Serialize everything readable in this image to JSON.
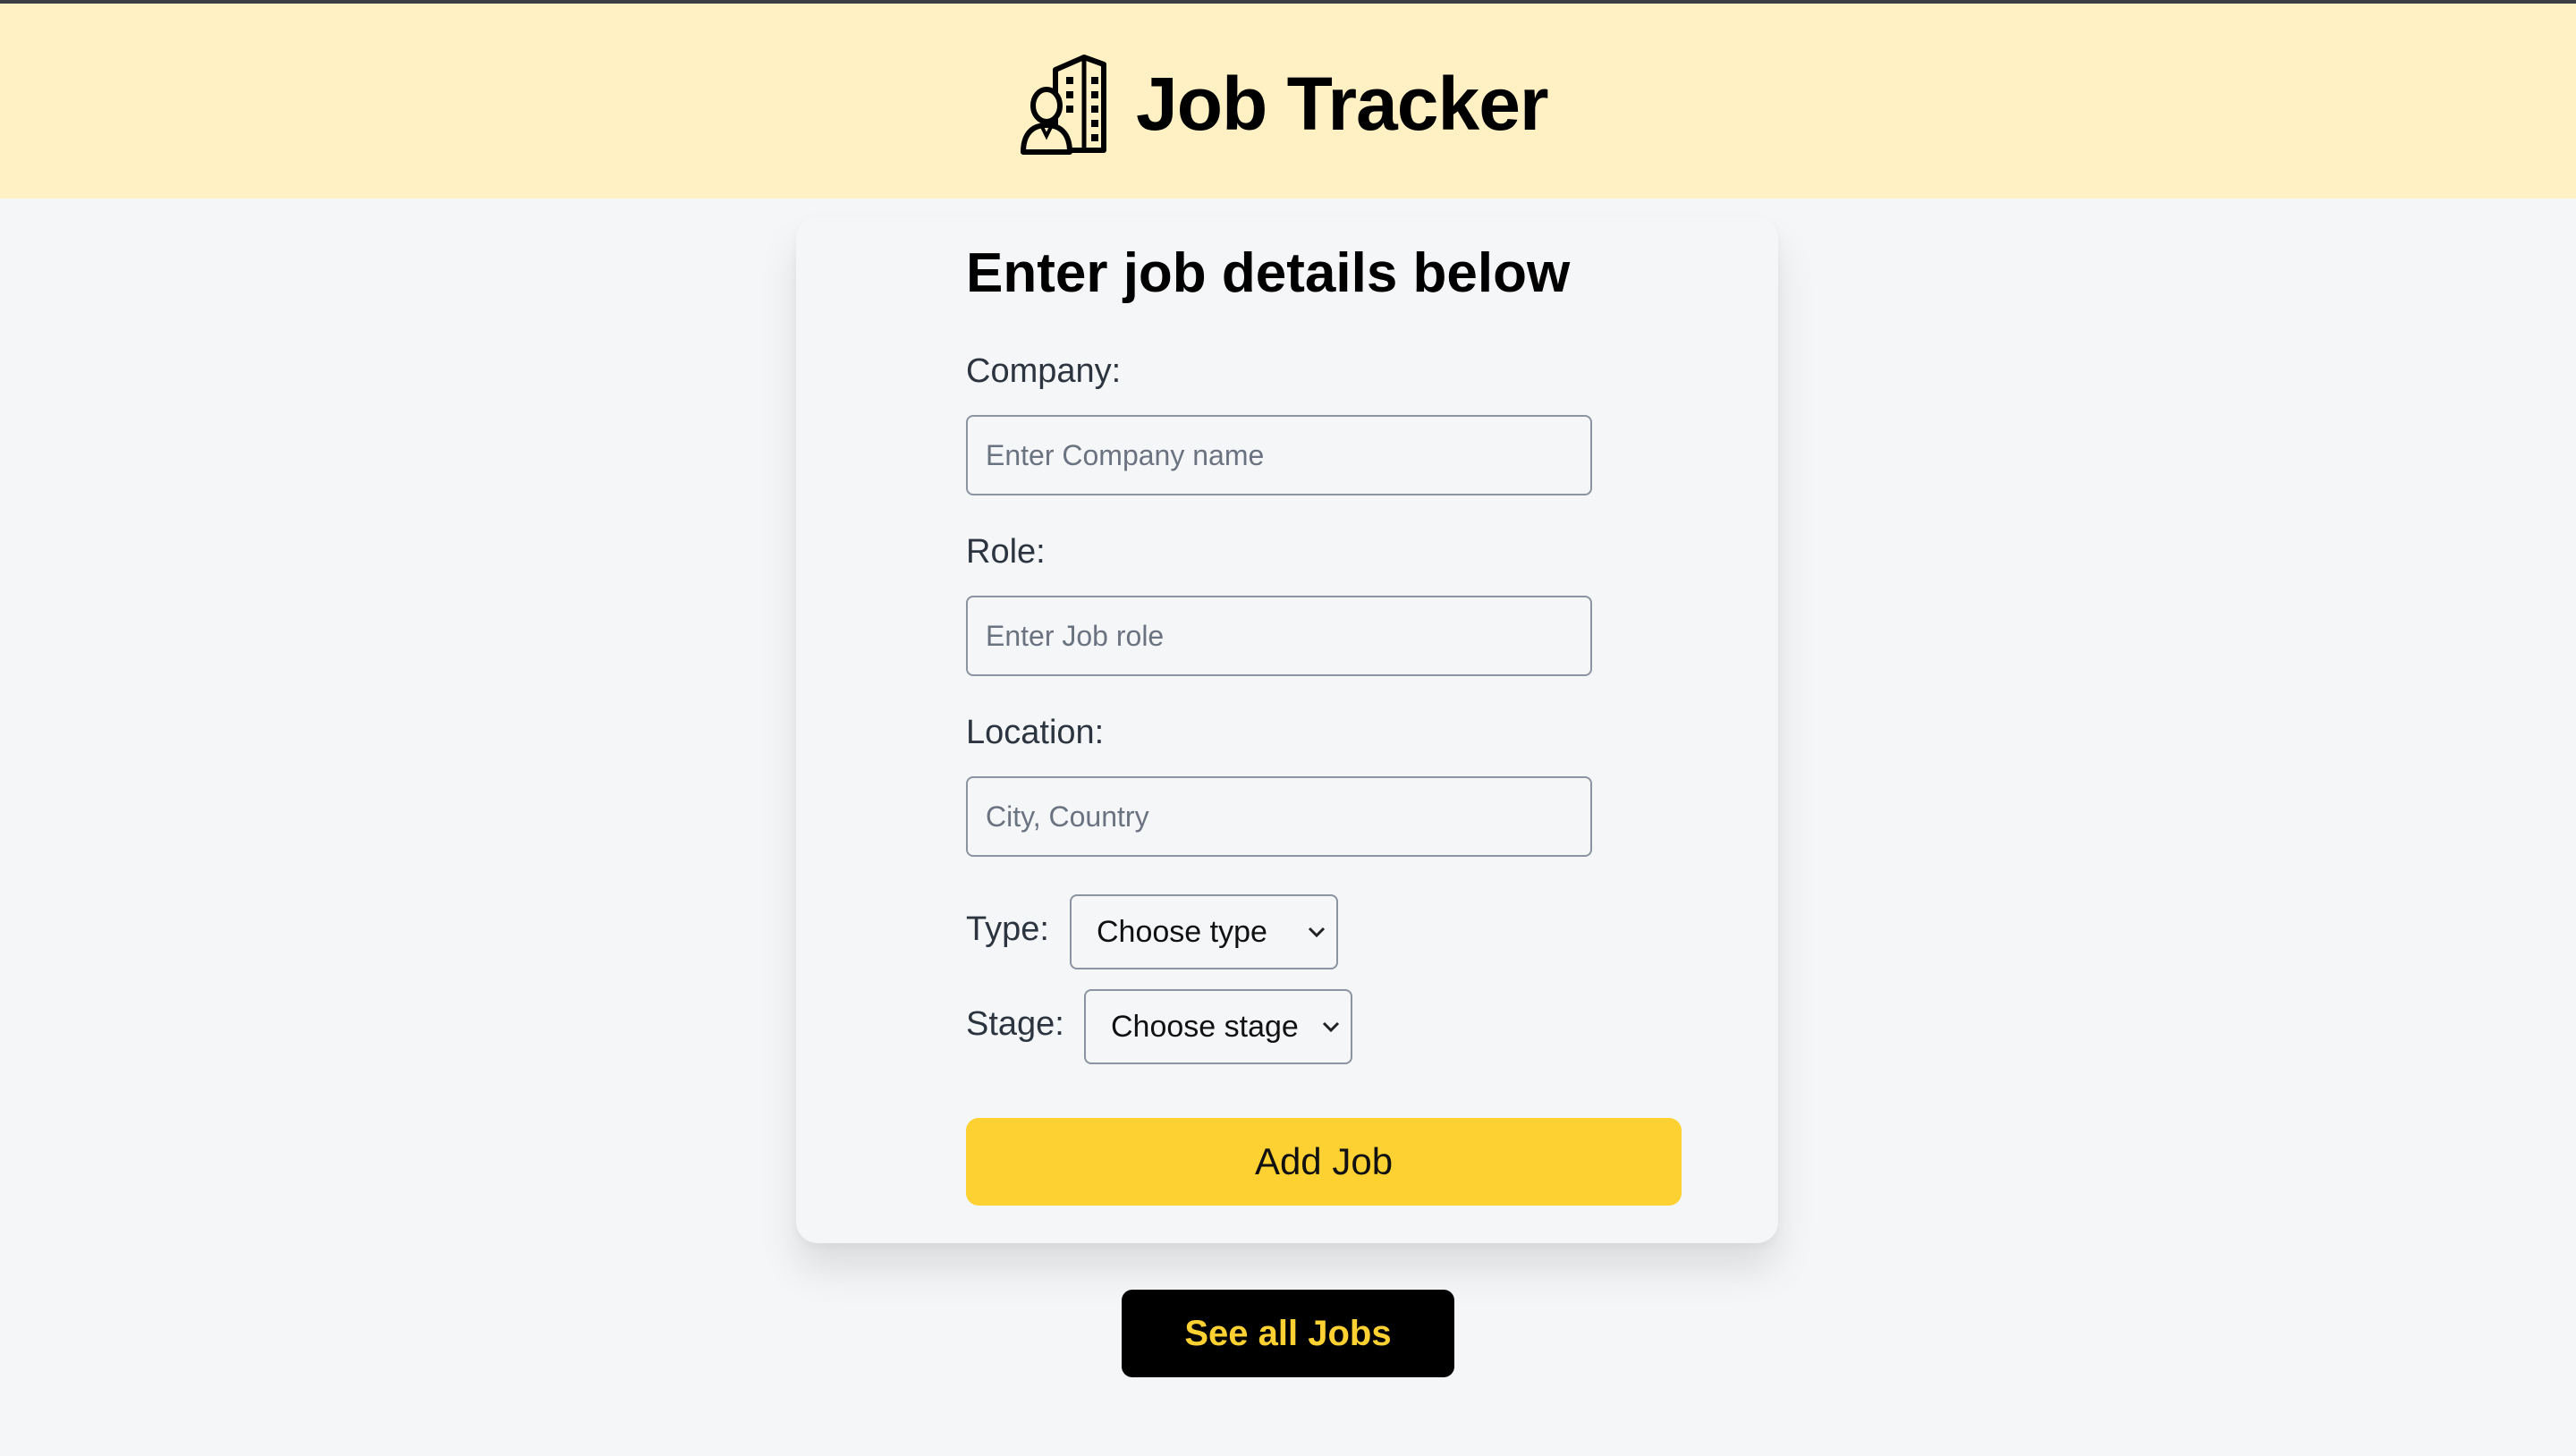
{
  "header": {
    "title": "Job Tracker",
    "icon": "building-person-icon",
    "background": "#fff1c4"
  },
  "form": {
    "heading": "Enter job details below",
    "company": {
      "label": "Company:",
      "placeholder": "Enter Company name",
      "value": ""
    },
    "role": {
      "label": "Role:",
      "placeholder": "Enter Job role",
      "value": ""
    },
    "location": {
      "label": "Location:",
      "placeholder": "City, Country",
      "value": ""
    },
    "type": {
      "label": "Type:",
      "selected": "Choose type"
    },
    "stage": {
      "label": "Stage:",
      "selected": "Choose stage"
    },
    "submit_label": "Add Job"
  },
  "footer": {
    "see_all_label": "See all Jobs"
  },
  "colors": {
    "accent": "#fdd131",
    "page_background": "#f5f6f8",
    "dark_button": "#000000"
  }
}
